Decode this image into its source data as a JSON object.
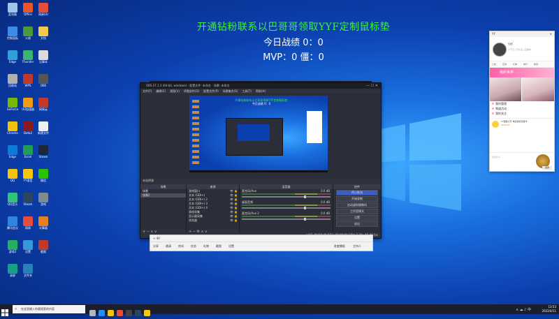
{
  "overlay": {
    "title": "开通钻粉联系以巴哥哥领取YYF定制鼠标垫",
    "stats_line1": "今日战绩 0：0",
    "stats_line2": "MVP：0  僵：0"
  },
  "obs": {
    "title": "OBS 27.1.3 (64-bit, windows) - 配置文件: 未命名 - 场景: 未命名",
    "menu": [
      "文件(F)",
      "编辑(E)",
      "视图(V)",
      "停靠部件(D)",
      "配置文件(P)",
      "场景集合(S)",
      "工具(T)",
      "帮助(H)"
    ],
    "status_left": "未选择源",
    "scenes_header": "场景",
    "scenes": [
      "场景",
      "场景2"
    ],
    "sources_header": "来源",
    "sources": [
      "游戏窗口",
      "文本 (GDI+)",
      "文本 (GDI+) 2",
      "文本 (GDI+) 3",
      "文本 (GDI+) 4",
      "游戏采集",
      "显示器采集",
      "浏览器"
    ],
    "mixer_header": "混音器",
    "mixer": [
      {
        "name": "麦克风/Aux",
        "db": "0.0 dB"
      },
      {
        "name": "桌面音频",
        "db": "0.0 dB"
      },
      {
        "name": "麦克风/Aux 2",
        "db": "0.0 dB"
      }
    ],
    "controls_header": "控件",
    "controls": [
      "停止推流",
      "开始录制",
      "启动虚拟摄像机",
      "工作室模式",
      "设置",
      "退出"
    ],
    "controls_primary": "停止推流",
    "status_bar": "LIVE: 00:56:48   REC: 00:00:00   CPU: 2.3%, 60.00 fps"
  },
  "lower_bar": {
    "row1": "< 40",
    "row2_items": [
      "分享",
      "邀请",
      "房间",
      "任务",
      "礼物",
      "截图",
      "设置"
    ],
    "right1": "进度播报",
    "right2": "主持人"
  },
  "chat": {
    "app_name": "YY",
    "username": "YYF",
    "signature": "人气王 | 已认证 | 直播中",
    "tabs": [
      "公告",
      "互动",
      "礼物",
      "排行",
      "粉丝"
    ],
    "banner": "我的世界",
    "list": [
      "我的管理",
      "频道活动",
      "我的关注"
    ],
    "gift_line1": "YY国民大厅·电竞鼠标高级卡",
    "gift_line2": "5000.00",
    "input_placeholder": "说点什么...",
    "send_label": "发送"
  },
  "desktop": {
    "icons": [
      {
        "label": "此电脑",
        "color": "#9fc6e8"
      },
      {
        "label": "Office",
        "color": "#e8552b"
      },
      {
        "label": "网易UU",
        "color": "#e74b3c"
      },
      {
        "label": "控制面板",
        "color": "#3c8de8"
      },
      {
        "label": "火绒",
        "color": "#4a9b3c"
      },
      {
        "label": "文档",
        "color": "#f2c94c"
      },
      {
        "label": "Edge",
        "color": "#2fa0d8"
      },
      {
        "label": "Thunder",
        "color": "#3cb371"
      },
      {
        "label": "记事本",
        "color": "#dcdcdc"
      },
      {
        "label": "回收站",
        "color": "#b0b0b0"
      },
      {
        "label": "WPS",
        "color": "#c0392b"
      },
      {
        "label": "OBS",
        "color": "#555555"
      },
      {
        "label": "GeForce",
        "color": "#76b900"
      },
      {
        "label": "UU加速器",
        "color": "#f39c12"
      },
      {
        "label": "网易云",
        "color": "#c0392b"
      },
      {
        "label": "Chrome",
        "color": "#f4c20d"
      },
      {
        "label": "Dota2",
        "color": "#8b1a1a"
      },
      {
        "label": "新建文件",
        "color": "#ecf0f1"
      },
      {
        "label": "Edge",
        "color": "#0f7bd8"
      },
      {
        "label": "Excel",
        "color": "#1f9d55"
      },
      {
        "label": "Steam",
        "color": "#1b2838"
      },
      {
        "label": "QQ",
        "color": "#f1c40f"
      },
      {
        "label": "YY语音",
        "color": "#f6c90e"
      },
      {
        "label": "微信",
        "color": "#2dc100"
      },
      {
        "label": "QQ音乐",
        "color": "#31c27c"
      },
      {
        "label": "Steam",
        "color": "#2a475e"
      },
      {
        "label": "游戏",
        "color": "#7f8c8d"
      },
      {
        "label": "腾讯会议",
        "color": "#2e86de"
      },
      {
        "label": "网易",
        "color": "#e74c3c"
      },
      {
        "label": "计算器",
        "color": "#e67e22"
      },
      {
        "label": "游戏2",
        "color": "#27ae60"
      },
      {
        "label": "设置",
        "color": "#3498db"
      },
      {
        "label": "截图",
        "color": "#c0392b"
      },
      {
        "label": "录屏",
        "color": "#16a085"
      },
      {
        "label": "文件夹",
        "color": "#2980b9"
      }
    ]
  },
  "taskbar": {
    "search_placeholder": "在这里输入你要搜索的内容",
    "time": "13:53",
    "date": "2022/4/11",
    "app_icons": [
      {
        "name": "task-view",
        "color": "#aab7c4"
      },
      {
        "name": "edge",
        "color": "#1e90ff"
      },
      {
        "name": "explorer",
        "color": "#f1c40f"
      },
      {
        "name": "chrome",
        "color": "#e74c3c"
      },
      {
        "name": "obs",
        "color": "#444444"
      },
      {
        "name": "steam",
        "color": "#2a475e"
      },
      {
        "name": "yy",
        "color": "#f6c90e"
      }
    ]
  },
  "colors": {
    "overlay_title": "#3df23d",
    "obs_bg": "#2b2e38",
    "start_blue": "#3b5dc9"
  }
}
